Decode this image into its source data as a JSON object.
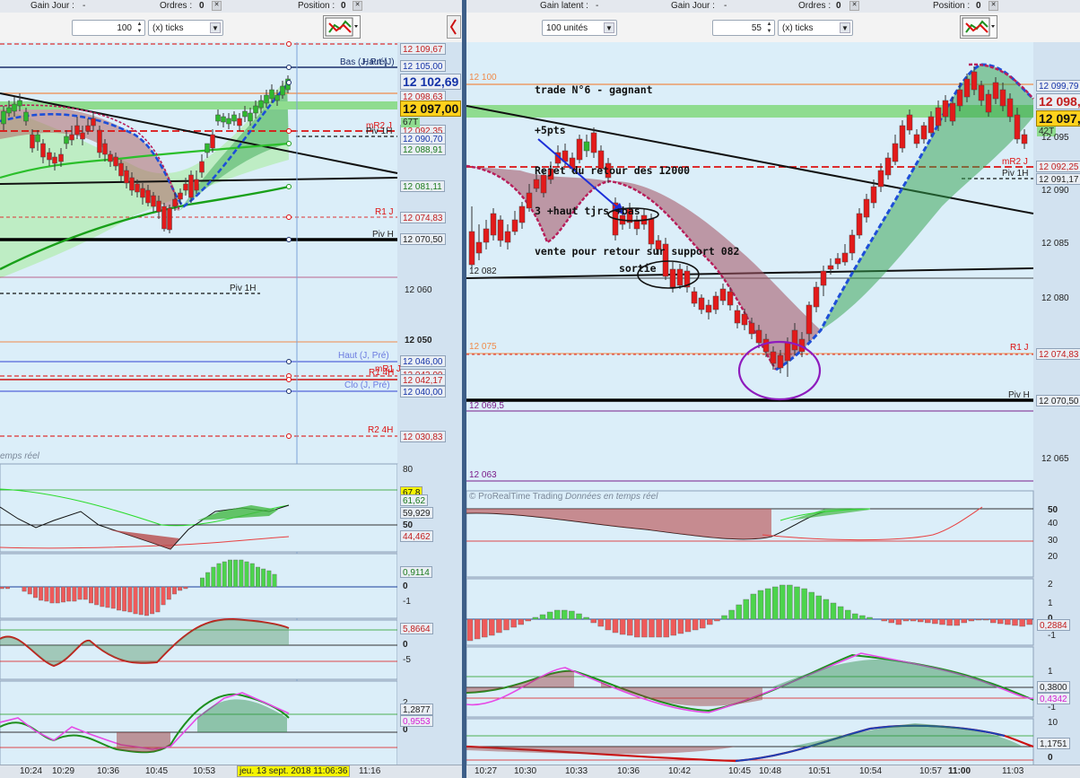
{
  "colors": {
    "bull": "#2fb82f",
    "bear": "#e31a1a",
    "sky": "#dbeef9",
    "header": "#e4e8ee"
  },
  "left": {
    "header": {
      "gain_label": "Gain Jour :",
      "gain_value": "-",
      "orders_label": "Ordres :",
      "orders_value": "0",
      "position_label": "Position :",
      "position_value": "0"
    },
    "toolbar": {
      "quantity": "100",
      "mode": "(x) ticks",
      "icon": "chart-tools-icon"
    },
    "price_tags": [
      {
        "text": "12 109,67",
        "cls": "red"
      },
      {
        "text": "12 105,00",
        "cls": "blue"
      },
      {
        "text": "12 102,69",
        "cls": "blue big"
      },
      {
        "text": "12 098,63",
        "cls": "red"
      },
      {
        "text": "12 097,00",
        "cls": "yellow big"
      },
      {
        "text": "12 092,35",
        "cls": "red"
      },
      {
        "text": "12 090,70",
        "cls": "blue"
      },
      {
        "text": "12 088,91",
        "cls": "green"
      },
      {
        "text": "12 081,11",
        "cls": "green"
      },
      {
        "text": "12 074,83",
        "cls": "red"
      },
      {
        "text": "12 070,50",
        "cls": "gray"
      },
      {
        "text": "12 046,00",
        "cls": "blue"
      },
      {
        "text": "12 043,00",
        "cls": "red"
      },
      {
        "text": "12 042,17",
        "cls": "red"
      },
      {
        "text": "12 040,00",
        "cls": "blue"
      },
      {
        "text": "12 030,83",
        "cls": "red"
      }
    ],
    "axis_ticks": [
      "12 060",
      "12 050"
    ],
    "line_labels": [
      "Bas (J, Pré)",
      "Haut (J)",
      "mR2 J",
      "67T",
      "Piv 1H",
      "R1 J",
      "Piv H",
      "Piv 1H",
      "Haut (J, Pré)",
      "R1 4H",
      "mR1 J",
      "Clo (J, Pré)",
      "R2 4H"
    ],
    "watermark": "emps réel",
    "osc1": {
      "ticks": [
        "80",
        "50"
      ],
      "tags": [
        "67,8",
        "61,62",
        "59,929",
        "44,462"
      ]
    },
    "osc2": {
      "ticks": [
        "0",
        "-1"
      ],
      "tags": [
        "0,9114"
      ]
    },
    "osc3": {
      "ticks": [
        "0",
        "-5"
      ],
      "tags": [
        "5,8664"
      ]
    },
    "osc4": {
      "ticks": [
        "2",
        "0"
      ],
      "tags": [
        "1,2877",
        "0,9553"
      ]
    },
    "xaxis": [
      "10:24",
      "10:29",
      "10:36",
      "10:45",
      "10:53",
      "11:16"
    ],
    "cursor_label": "jeu. 13 sept. 2018 11:06:36"
  },
  "right": {
    "header": {
      "gain_label": "Gain latent :",
      "gain_value": "-",
      "gainj_label": "Gain Jour :",
      "gainj_value": "-",
      "orders_label": "Ordres :",
      "orders_value": "0",
      "position_label": "Position :",
      "position_value": "0"
    },
    "toolbar": {
      "units": "100 unités",
      "quantity": "55",
      "mode": "(x) ticks",
      "icon": "chart-tools-icon"
    },
    "annotation": [
      "trade N°6 - gagnant",
      "+5pts",
      "Rejet du retour des 12000",
      "3 +haut tjrs +bas",
      "vente pour retour sur support 082"
    ],
    "sortie_label": "sortie",
    "level_labels": [
      "12 100",
      "12 082",
      "12 075",
      "12 069,5",
      "12 063"
    ],
    "line_labels": [
      "mR2 J",
      "Piv 1H",
      "R1 J",
      "Piv H"
    ],
    "price_tags": [
      {
        "text": "12 099,79",
        "cls": "blue"
      },
      {
        "text": "12 098,",
        "cls": "red big"
      },
      {
        "text": "12 097,",
        "cls": "yellow big"
      },
      {
        "text": "12 092,25",
        "cls": "red"
      },
      {
        "text": "12 091,17",
        "cls": "gray"
      },
      {
        "text": "12 074,83",
        "cls": "red"
      },
      {
        "text": "12 070,50",
        "cls": "gray"
      }
    ],
    "tick_label": "42T",
    "axis_ticks": [
      "12 095",
      "12 090",
      "12 085",
      "12 080",
      "12 065"
    ],
    "watermark_brand": "© ProRealTime Trading",
    "watermark_text": "Données en temps réel",
    "osc1": {
      "ticks": [
        "50",
        "40",
        "30",
        "20"
      ]
    },
    "osc2": {
      "ticks": [
        "2",
        "1",
        "0",
        "-1"
      ],
      "tags": [
        "0,2884"
      ]
    },
    "osc3": {
      "ticks": [
        "1",
        "0",
        "-1"
      ],
      "tags": [
        "0,3800",
        "0,4342"
      ]
    },
    "osc4": {
      "ticks": [
        "10",
        "0"
      ],
      "tags": [
        "1,1751"
      ]
    },
    "xaxis": [
      "10:27",
      "10:30",
      "10:33",
      "10:36",
      "10:42",
      "10:45",
      "10:48",
      "10:51",
      "10:54",
      "10:57",
      "11:00",
      "11:03"
    ]
  }
}
